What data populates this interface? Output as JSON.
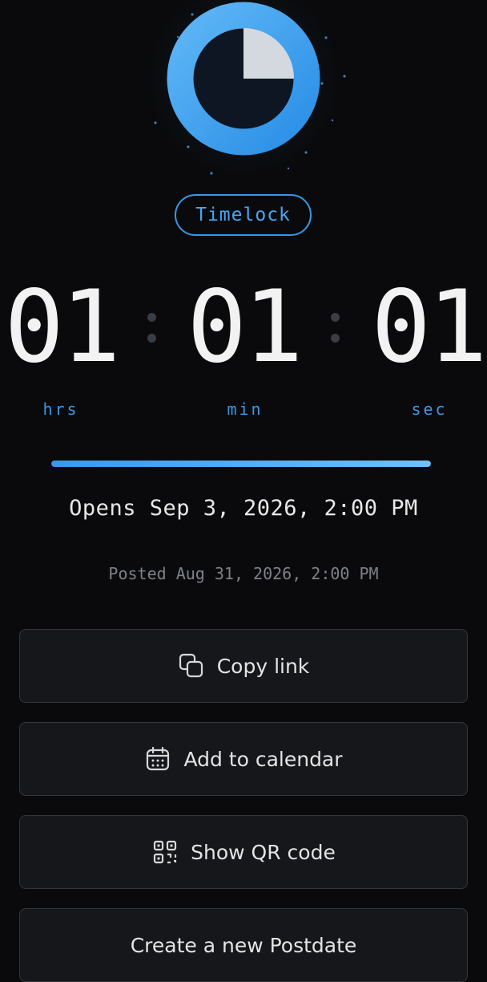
{
  "badge": {
    "label": "Timelock"
  },
  "countdown": {
    "hours": "01",
    "minutes": "01",
    "seconds": "01",
    "hours_unit": "hrs",
    "minutes_unit": "min",
    "seconds_unit": "sec",
    "progress_fraction": 1.0
  },
  "schedule": {
    "opens_text": "Opens Sep 3, 2026, 2:00 PM",
    "posted_text": "Posted Aug 31, 2026, 2:00 PM"
  },
  "actions": {
    "copy_link": {
      "label": "Copy link",
      "icon": "copy-icon"
    },
    "add_calendar": {
      "label": "Add to calendar",
      "icon": "calendar-icon"
    },
    "show_qr": {
      "label": "Show QR code",
      "icon": "qr-code-icon"
    },
    "create_new": {
      "label": "Create a new Postdate"
    }
  },
  "colors": {
    "accent": "#3a97e6",
    "background": "#0a0a0c",
    "button_bg": "#16171b",
    "button_border": "#34363c",
    "pie_fill": "#d4d9e0"
  }
}
